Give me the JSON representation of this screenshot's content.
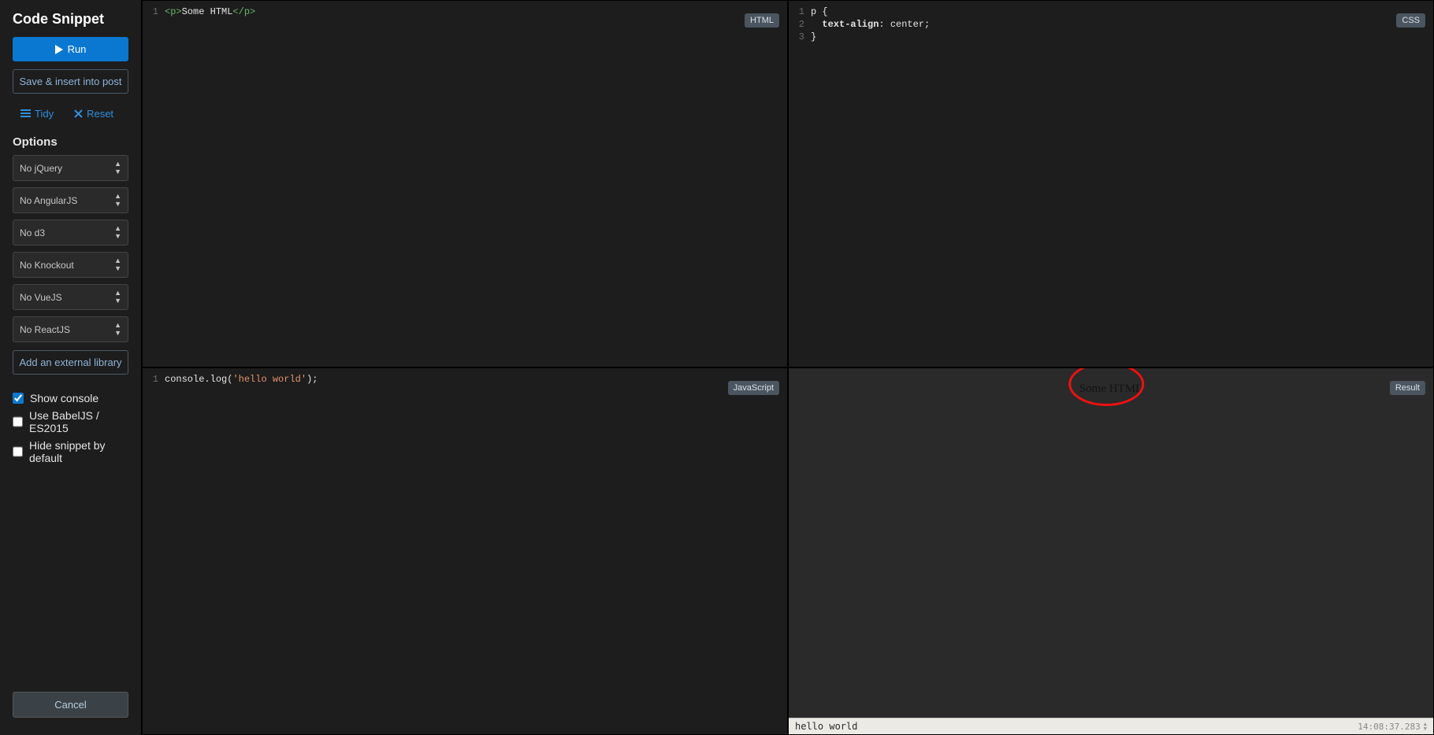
{
  "sidebar": {
    "title": "Code Snippet",
    "run_label": "Run",
    "save_label": "Save & insert into post",
    "tidy_label": "Tidy",
    "reset_label": "Reset",
    "options_title": "Options",
    "selects": [
      "No jQuery",
      "No AngularJS",
      "No d3",
      "No Knockout",
      "No VueJS",
      "No ReactJS"
    ],
    "add_lib_label": "Add an external library",
    "checkboxes": [
      {
        "label": "Show console",
        "checked": true
      },
      {
        "label": "Use BabelJS / ES2015",
        "checked": false
      },
      {
        "label": "Hide snippet by default",
        "checked": false
      }
    ],
    "cancel_label": "Cancel"
  },
  "panes": {
    "html": {
      "label": "HTML",
      "lines": [
        {
          "n": "1",
          "tokens": [
            {
              "t": "<",
              "c": "tag"
            },
            {
              "t": "p",
              "c": "tag"
            },
            {
              "t": ">",
              "c": "tag"
            },
            {
              "t": "Some HTML",
              "c": "text"
            },
            {
              "t": "</",
              "c": "tag"
            },
            {
              "t": "p",
              "c": "tag"
            },
            {
              "t": ">",
              "c": "tag"
            }
          ]
        }
      ]
    },
    "css": {
      "label": "CSS",
      "lines": [
        {
          "n": "1",
          "tokens": [
            {
              "t": "p ",
              "c": "key"
            },
            {
              "t": "{",
              "c": "punct"
            }
          ]
        },
        {
          "n": "2",
          "tokens": [
            {
              "t": "  text-align",
              "c": "prop"
            },
            {
              "t": ": ",
              "c": "punct"
            },
            {
              "t": "center",
              "c": "key"
            },
            {
              "t": ";",
              "c": "punct"
            }
          ]
        },
        {
          "n": "3",
          "tokens": [
            {
              "t": "}",
              "c": "punct"
            }
          ]
        }
      ]
    },
    "js": {
      "label": "JavaScript",
      "lines": [
        {
          "n": "1",
          "tokens": [
            {
              "t": "console",
              "c": "key"
            },
            {
              "t": ".",
              "c": "punct"
            },
            {
              "t": "log",
              "c": "key"
            },
            {
              "t": "(",
              "c": "punct"
            },
            {
              "t": "'hello world'",
              "c": "str"
            },
            {
              "t": ")",
              "c": "punct"
            },
            {
              "t": ";",
              "c": "punct"
            }
          ]
        }
      ]
    },
    "result": {
      "label": "Result",
      "output_text": "Some HTML",
      "console_text": "hello world",
      "console_time": "14:08:37.283"
    }
  }
}
